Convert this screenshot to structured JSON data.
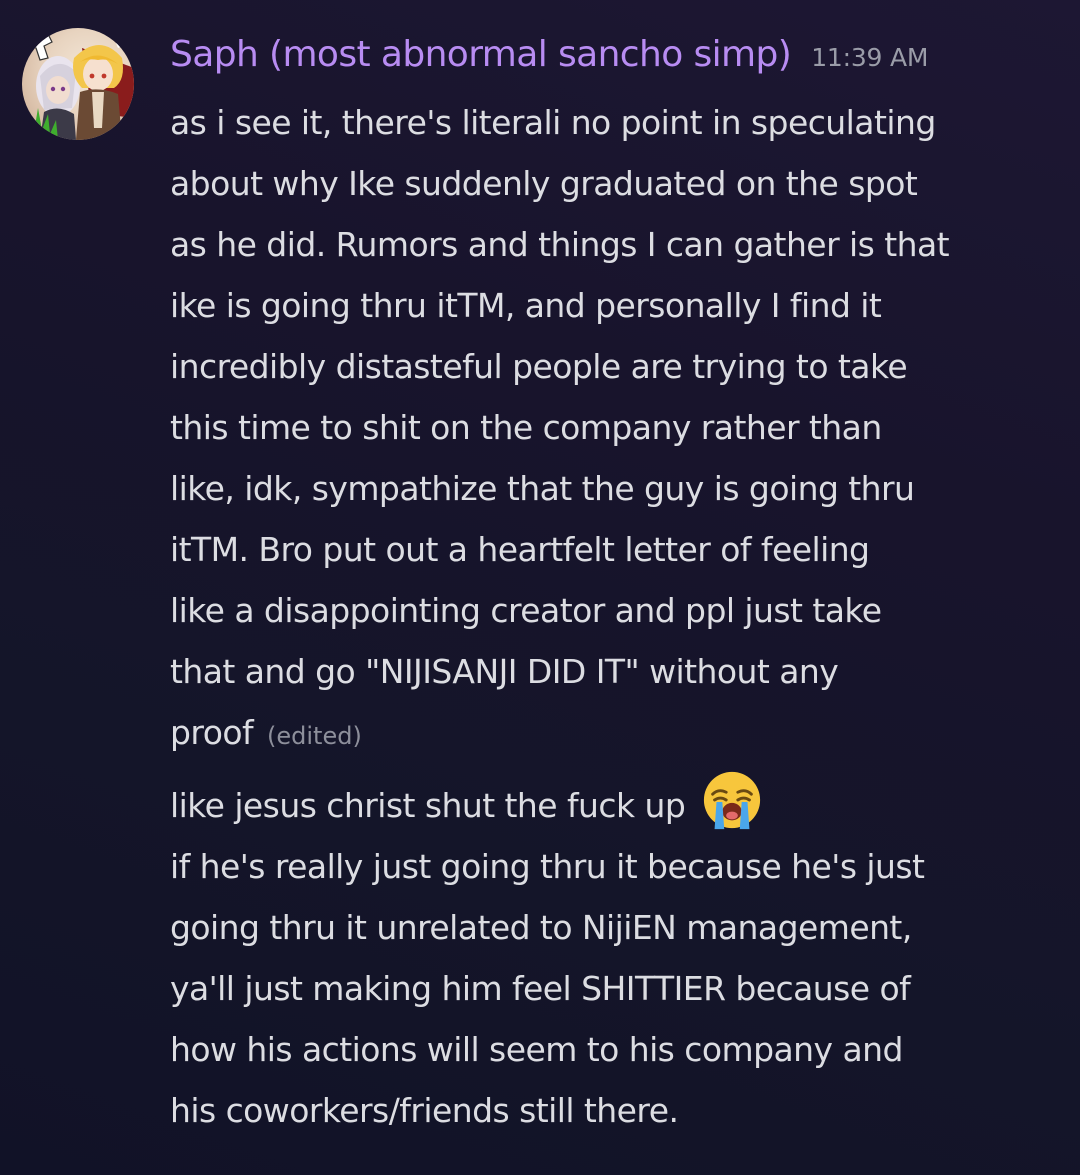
{
  "message": {
    "author": "Saph (most abnormal sancho simp)",
    "timestamp": "11:39 AM",
    "first_post": {
      "lines": [
        "as i see it, there's literali no point in speculating",
        "about why Ike suddenly graduated on the spot",
        "as he did. Rumors and things I can gather is that",
        "ike is going thru itTM, and personally I find it",
        "incredibly distasteful people are trying to take",
        "this time to shit on the company rather than",
        "like, idk, sympathize that the guy is going thru",
        "itTM. Bro put out a heartfelt letter of feeling",
        "like a disappointing creator and ppl just take",
        "that and go \"NIJISANJI DID IT\" without any",
        "proof"
      ],
      "edited_label": "(edited)"
    },
    "second_post": {
      "text": "like jesus christ shut the fuck up",
      "emoji": "loudly-crying-face-emoji"
    },
    "third_post": {
      "lines": [
        "if he's really  just going thru it because he's just",
        "going thru it unrelated to NijiEN management,",
        "ya'll just making him feel SHITTIER because of",
        "how his actions will seem to his company and",
        "his coworkers/friends still there."
      ]
    }
  },
  "colors": {
    "username": "#b88cf2",
    "message_text": "#dcdde2",
    "timestamp": "#9a9ca8",
    "background": "#18142c"
  }
}
